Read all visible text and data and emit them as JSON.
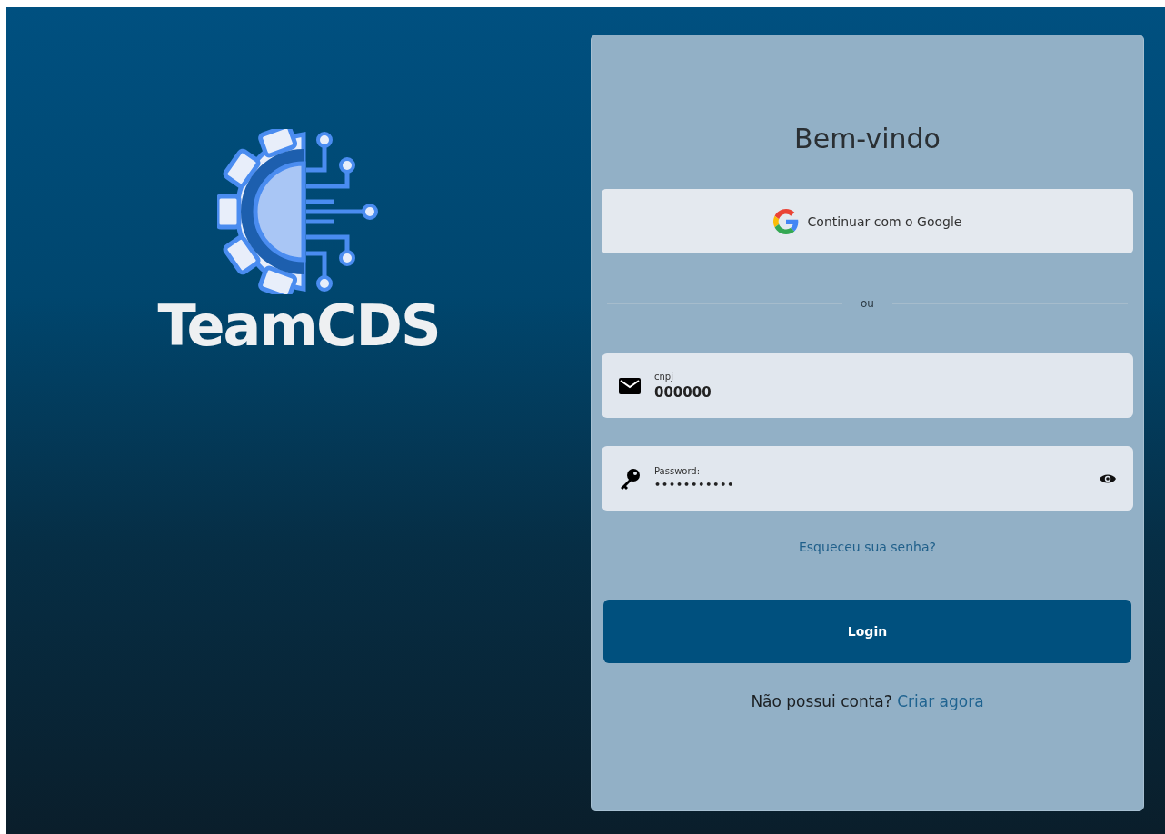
{
  "brand": {
    "name": "TeamCDS"
  },
  "login": {
    "title": "Bem-vindo",
    "google_button": "Continuar com o  Google",
    "separator": "ou",
    "fields": [
      {
        "kind": "email",
        "label": "cnpj",
        "value": "000000"
      },
      {
        "kind": "password",
        "label": "Password:",
        "value": "•••••••••••"
      }
    ],
    "forgot_link": "Esqueceu sua senha?",
    "submit_button": "Login",
    "signup_prompt": "Não possui conta?",
    "signup_link": "Criar agora"
  }
}
